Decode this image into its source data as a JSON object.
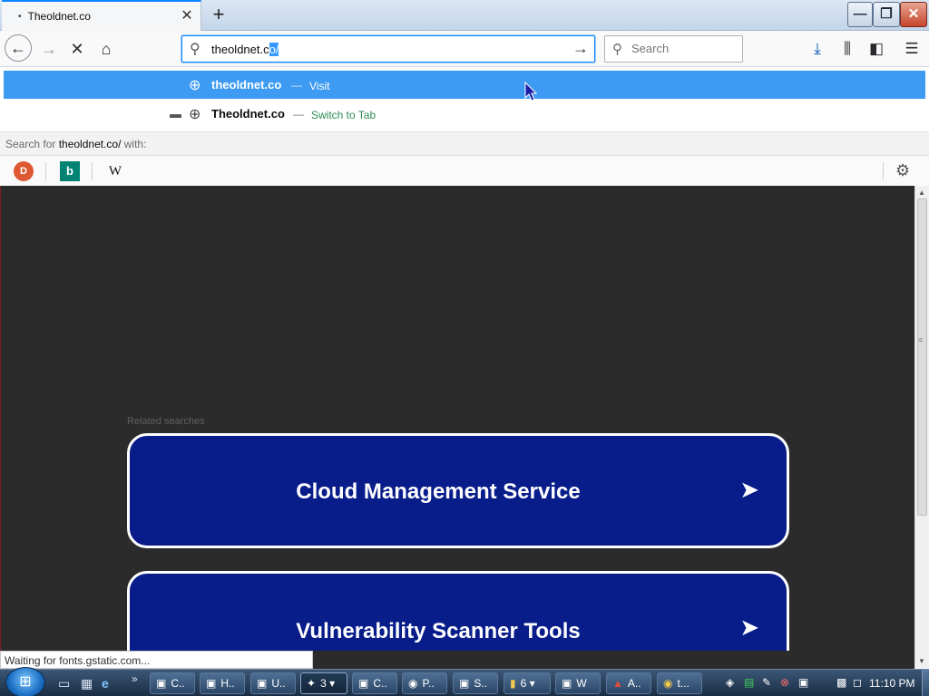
{
  "window": {
    "tab_title": "Theoldnet.co",
    "tab_dot": "•",
    "tab_close": "✕",
    "new_tab": "+",
    "minimize": "—",
    "maximize": "❐",
    "close": "✕"
  },
  "navbar": {
    "back": "←",
    "forward": "→",
    "stop": "✕",
    "home": "⌂",
    "url_typed": "theoldnet.c",
    "url_selected": "o/",
    "url_go": "→",
    "search_placeholder": "Search",
    "search_icon": "⚲",
    "download_icon": "⤓",
    "library_icon": "⫼",
    "sidebar_icon": "◧",
    "menu_icon": "☰"
  },
  "autocomplete": {
    "items": [
      {
        "title": "theoldnet.co",
        "separator": "—",
        "action": "Visit",
        "icon": "globe-icon",
        "glyph": "⊕"
      },
      {
        "title": "Theoldnet.co",
        "separator": "—",
        "action": "Switch to Tab",
        "icon": "globe-icon",
        "glyph": "⊕",
        "tab_glyph": "▬"
      }
    ],
    "search_hint_prefix": "Search for ",
    "search_hint_term": "theoldnet.co/",
    "search_hint_suffix": " with:",
    "engines": [
      {
        "name": "DuckDuckGo",
        "glyph": "D"
      },
      {
        "name": "Bing",
        "glyph": "b"
      },
      {
        "name": "Wikipedia",
        "glyph": "W"
      }
    ],
    "settings_glyph": "⚙"
  },
  "page": {
    "related_label": "Related searches",
    "cards": [
      {
        "label": "Cloud Management Service",
        "arrow": "➤"
      },
      {
        "label": "Vulnerability Scanner Tools",
        "arrow": "➤"
      }
    ]
  },
  "scrollbar": {
    "up": "▲",
    "down": "▼",
    "grip": "≡"
  },
  "status": {
    "text": "Waiting for fonts.gstatic.com..."
  },
  "taskbar": {
    "start_glyph": "⊞",
    "quicklaunch": [
      "▭",
      "▦",
      "e",
      "»"
    ],
    "buttons": [
      {
        "label": "C..",
        "icon": "▣"
      },
      {
        "label": "H..",
        "icon": "▣"
      },
      {
        "label": "U..",
        "icon": "▣"
      },
      {
        "label": "3 ▾",
        "icon": "✦"
      },
      {
        "label": "C..",
        "icon": "▣"
      },
      {
        "label": "P..",
        "icon": "◉"
      },
      {
        "label": "S..",
        "icon": "▣"
      },
      {
        "label": "6 ▾",
        "icon": "▮"
      },
      {
        "label": "W",
        "icon": "▣"
      },
      {
        "label": "A..",
        "icon": "▲"
      },
      {
        "label": "t...",
        "icon": "◉"
      }
    ],
    "tray_icons": [
      "◈",
      "▤",
      "✎",
      "⊗",
      "▣",
      "▩",
      "◻"
    ],
    "clock": "11:10 PM"
  },
  "colors": {
    "accent": "#0a84ff",
    "highlight_row": "#3d9bf3",
    "page_bg": "#2b2b2b",
    "card_bg": "#081d8a",
    "switch_tab_green": "#2e8b57"
  }
}
